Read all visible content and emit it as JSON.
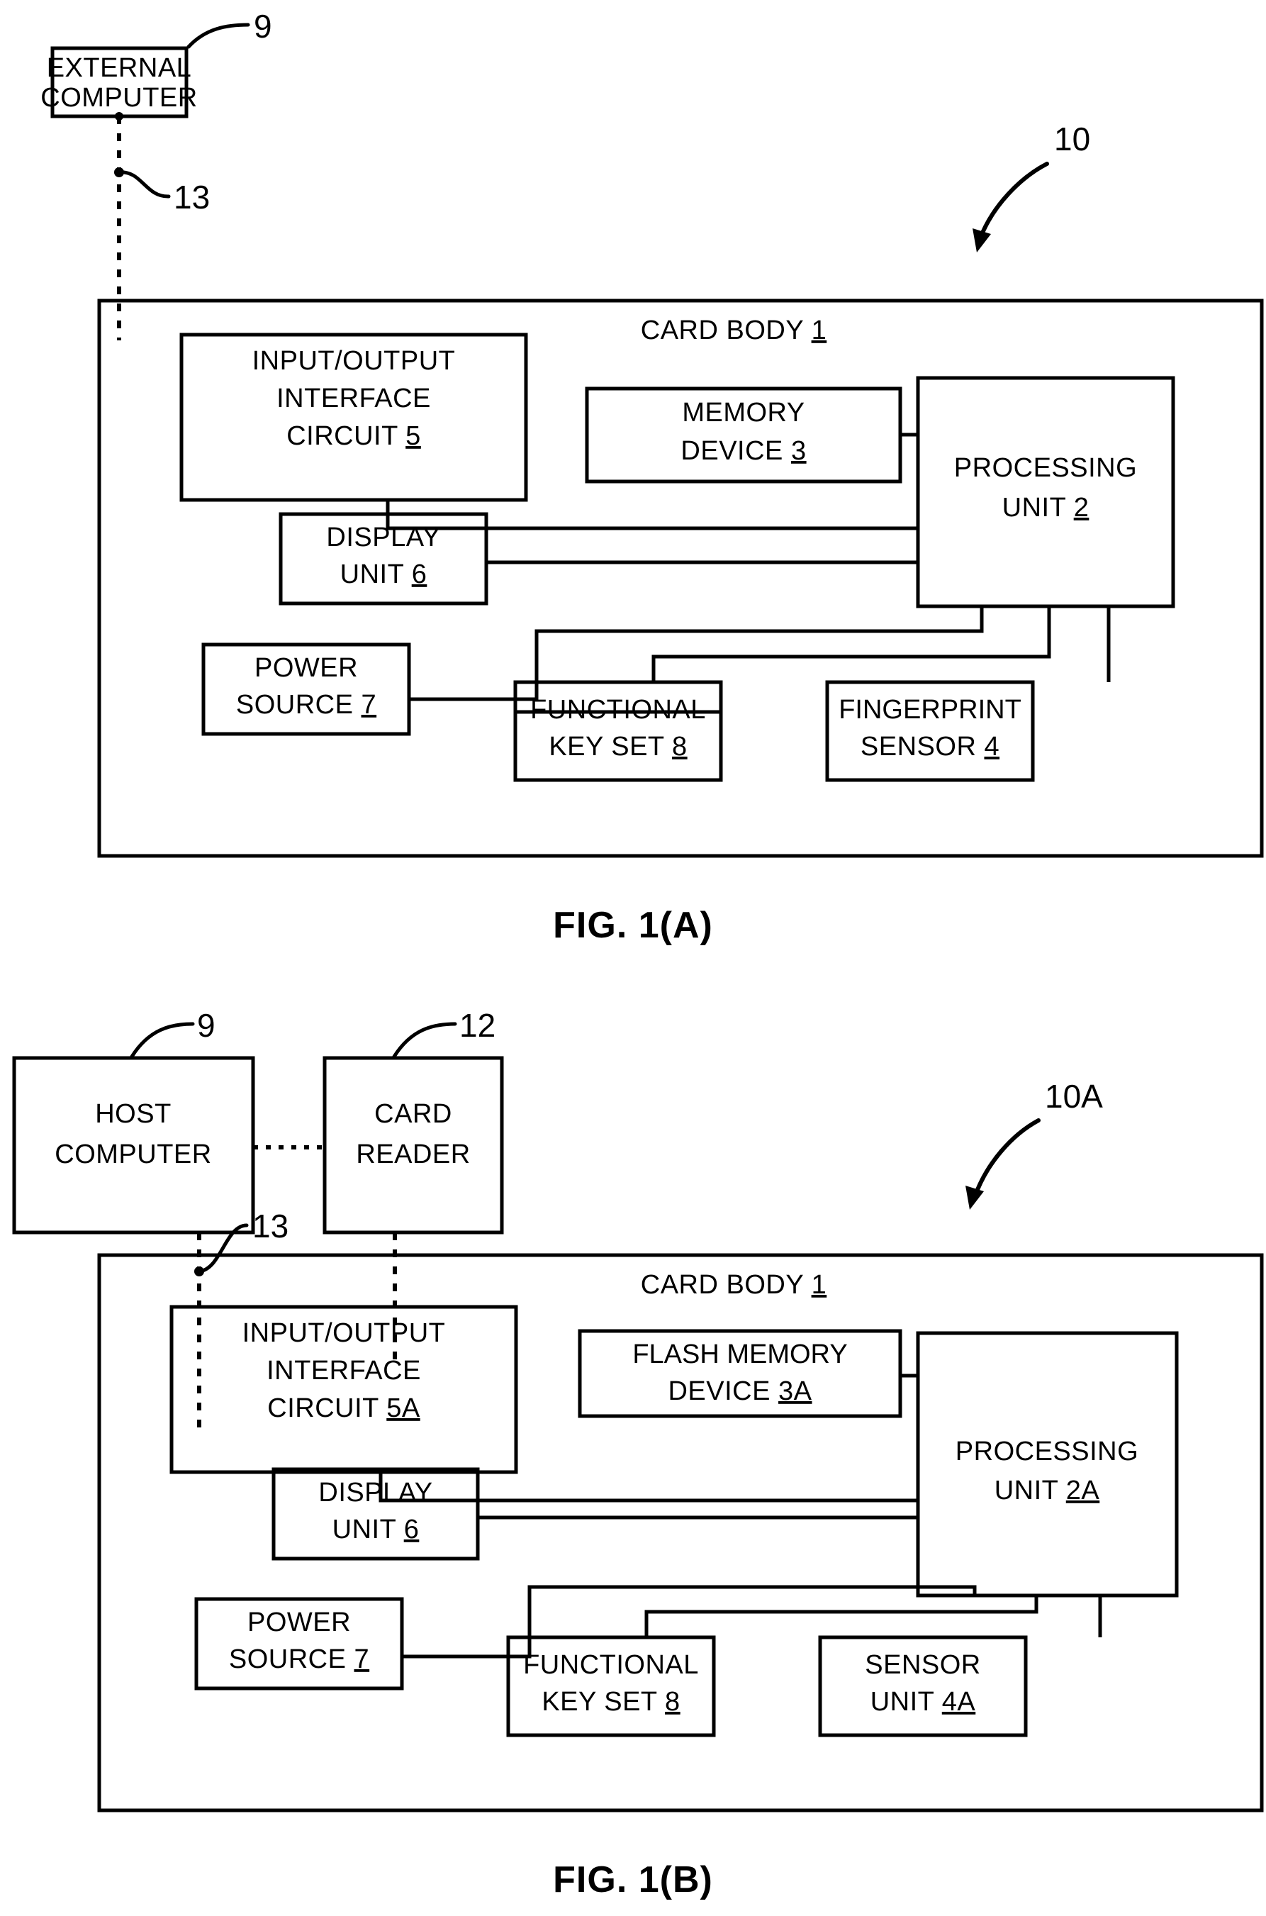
{
  "figures": [
    {
      "id": "fig-1a",
      "caption": "FIG. 1(A)",
      "system_ref": "10",
      "external_box": {
        "line1": "EXTERNAL",
        "line2": "COMPUTER",
        "ref": "9"
      },
      "link_ref": "13",
      "card_body": {
        "label": "CARD BODY",
        "ref": "1"
      },
      "blocks": [
        {
          "name": "io-interface",
          "line1": "INPUT/OUTPUT",
          "line2": "INTERFACE",
          "line3": "CIRCUIT",
          "ref": "5"
        },
        {
          "name": "memory-device",
          "line1": "MEMORY",
          "line2": "DEVICE",
          "ref": "3"
        },
        {
          "name": "processing-unit",
          "line1": "PROCESSING",
          "line2": "UNIT",
          "ref": "2"
        },
        {
          "name": "display-unit",
          "line1": "DISPLAY",
          "line2": "UNIT",
          "ref": "6"
        },
        {
          "name": "power-source",
          "line1": "POWER",
          "line2": "SOURCE",
          "ref": "7"
        },
        {
          "name": "functional-key-set",
          "line1": "FUNCTIONAL",
          "line2": "KEY SET",
          "ref": "8"
        },
        {
          "name": "fingerprint-sensor",
          "line1": "FINGERPRINT",
          "line2": "SENSOR",
          "ref": "4"
        }
      ]
    },
    {
      "id": "fig-1b",
      "caption": "FIG. 1(B)",
      "system_ref": "10A",
      "host_box": {
        "line1": "HOST",
        "line2": "COMPUTER",
        "ref": "9"
      },
      "reader_box": {
        "line1": "CARD",
        "line2": "READER",
        "ref": "12"
      },
      "link_ref": "13",
      "card_body": {
        "label": "CARD BODY",
        "ref": "1"
      },
      "blocks": [
        {
          "name": "io-interface",
          "line1": "INPUT/OUTPUT",
          "line2": "INTERFACE",
          "line3": "CIRCUIT",
          "ref": "5A"
        },
        {
          "name": "flash-memory-device",
          "line1": "FLASH MEMORY",
          "line2": "DEVICE",
          "ref": "3A"
        },
        {
          "name": "processing-unit",
          "line1": "PROCESSING",
          "line2": "UNIT",
          "ref": "2A"
        },
        {
          "name": "display-unit",
          "line1": "DISPLAY",
          "line2": "UNIT",
          "ref": "6"
        },
        {
          "name": "power-source",
          "line1": "POWER",
          "line2": "SOURCE",
          "ref": "7"
        },
        {
          "name": "functional-key-set",
          "line1": "FUNCTIONAL",
          "line2": "KEY SET",
          "ref": "8"
        },
        {
          "name": "sensor-unit",
          "line1": "SENSOR",
          "line2": "UNIT",
          "ref": "4A"
        }
      ]
    }
  ],
  "colors": {
    "ink": "#000000",
    "paper": "#ffffff"
  }
}
